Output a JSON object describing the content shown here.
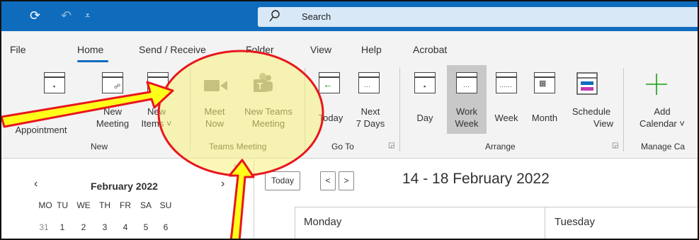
{
  "titlebar": {
    "search_label": "Search",
    "icons": [
      "sync-icon",
      "undo-icon",
      "customize-quick-access-icon",
      "search-icon"
    ],
    "accent": "#0f6cbd"
  },
  "menu": {
    "tabs": [
      "File",
      "Home",
      "Send / Receive",
      "Folder",
      "View",
      "Help",
      "Acrobat"
    ],
    "active": "Home"
  },
  "ribbon": {
    "new_group": {
      "label": "New",
      "appointment": "Appointment",
      "new_meeting_1": "New",
      "new_meeting_2": "Meeting",
      "new_items_1": "New",
      "new_items_2": "Items"
    },
    "teams_group": {
      "label": "Teams Meeting",
      "meet_now_1": "Meet",
      "meet_now_2": "Now",
      "new_teams_1": "New Teams",
      "new_teams_2": "Meeting"
    },
    "goto_group": {
      "label": "Go To",
      "today": "Today",
      "next7_1": "Next",
      "next7_2": "7 Days"
    },
    "arrange_group": {
      "label": "Arrange",
      "day": "Day",
      "work_week_1": "Work",
      "work_week_2": "Week",
      "week": "Week",
      "month": "Month",
      "schedule_1": "Schedule",
      "schedule_2": "View"
    },
    "manage_group": {
      "label": "Manage Ca",
      "add_1": "Add",
      "add_2": "Calendar"
    }
  },
  "navpanel": {
    "month": "February 2022",
    "days_of_week": [
      "MO",
      "TU",
      "WE",
      "TH",
      "FR",
      "SA",
      "SU"
    ],
    "first_row": [
      "31",
      "1",
      "2",
      "3",
      "4",
      "5",
      "6"
    ]
  },
  "main": {
    "today_button": "Today",
    "prev_glyph": "<",
    "next_glyph": ">",
    "date_range": "14 - 18 February 2022",
    "day_headers": [
      "Monday",
      "Tuesday"
    ]
  },
  "annotation": {
    "circle_color": "#e8161d",
    "highlight_color": "#f7f07a",
    "arrow_color": "#ffff1a"
  }
}
